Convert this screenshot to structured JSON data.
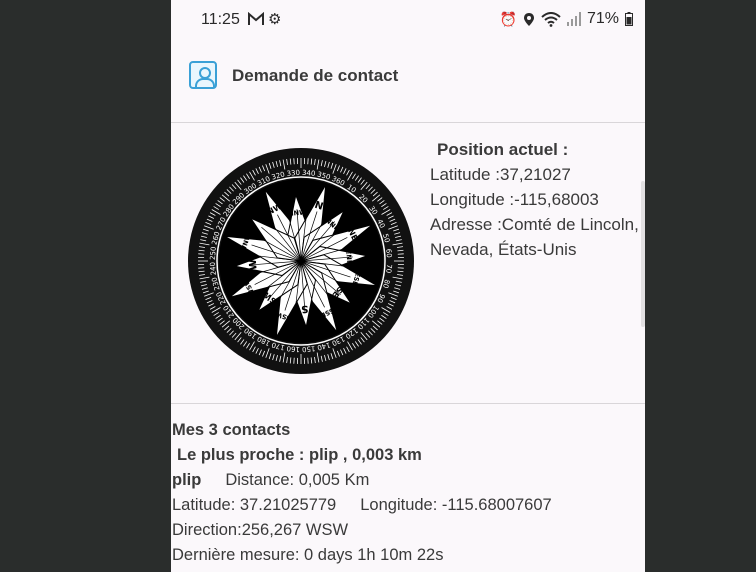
{
  "status_bar": {
    "time": "11:25",
    "gmail_icon": "gmail-icon",
    "settings_icon": "gear-icon",
    "battery": "71%"
  },
  "app_bar": {
    "title": "Demande de contact"
  },
  "compass": {
    "ring_labels": [
      "270",
      "280",
      "290",
      "300",
      "310",
      "320",
      "330",
      "340",
      "350",
      "360",
      "10",
      "20",
      "30",
      "40",
      "50",
      "60",
      "70",
      "80",
      "90",
      "100",
      "110",
      "120",
      "130",
      "140",
      "150",
      "160",
      "170",
      "180",
      "190",
      "200",
      "210",
      "220",
      "230",
      "240",
      "250",
      "260"
    ],
    "rose_labels": [
      "NW",
      "NNW",
      "N",
      "NNE",
      "NE",
      "ENE",
      "ESE",
      "SE",
      "SSE",
      "S",
      "SSW",
      "SW",
      "WSW",
      "W",
      "WNW"
    ]
  },
  "position": {
    "title": "Position actuel :",
    "latitude": "Latitude :37,21027",
    "longitude": "Longitude :-115,68003",
    "address": "Adresse :Comté de Lincoln, Nevada, États-Unis"
  },
  "contacts": {
    "header": "Mes 3 contacts",
    "nearest": "Le plus proche : plip , 0,003 km",
    "contact1": {
      "name": "plip",
      "distance": "Distance: 0,005 Km",
      "latitude": "Latitude: 37.21025779",
      "longitude": "Longitude: -115.68007607",
      "direction": "Direction:256,267 WSW",
      "last_measure": "Dernière mesure: 0 days 1h 10m 22s"
    }
  }
}
